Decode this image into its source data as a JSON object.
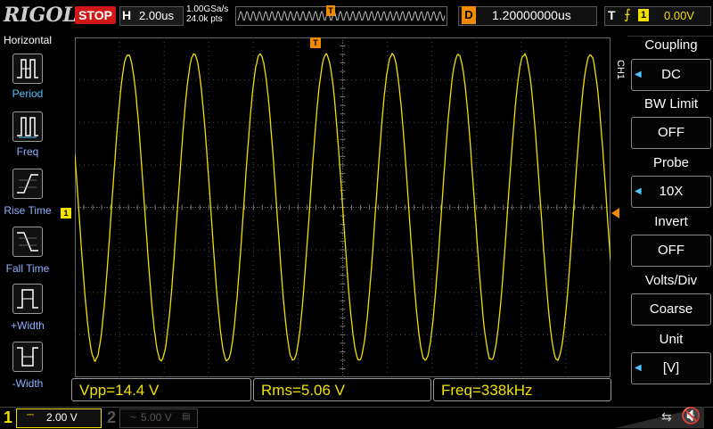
{
  "topbar": {
    "brand": "RIGOL",
    "run_status": "STOP",
    "horizontal_label": "H",
    "timebase": "2.00us",
    "sample_rate": "1.00GSa/s",
    "memory_depth": "24.0k pts",
    "trigger_marker": "T",
    "delay_label": "D",
    "delay_value": "1.20000000us",
    "trigger_label": "T",
    "trigger_source": "1",
    "trigger_level": "0.00V"
  },
  "left_menu": {
    "title": "Horizontal",
    "items": [
      {
        "label": "Period",
        "icon": "period-icon"
      },
      {
        "label": "Freq",
        "icon": "frequency-icon"
      },
      {
        "label": "Rise Time",
        "icon": "rise-time-icon"
      },
      {
        "label": "Fall Time",
        "icon": "fall-time-icon"
      },
      {
        "label": "+Width",
        "icon": "positive-width-icon"
      },
      {
        "label": "-Width",
        "icon": "negative-width-icon"
      }
    ]
  },
  "waveform": {
    "channel": "1",
    "color": "#f0e000",
    "vpp_volts": 14.4,
    "frequency_khz": 338,
    "timebase_us_per_div": 2.0,
    "volts_per_div": 2.0,
    "channel_marker": "1",
    "trigger_marker": "T"
  },
  "measurements": {
    "vpp": "Vpp=14.4 V",
    "rms": "Rms=5.06 V",
    "freq": "Freq=338kHz"
  },
  "right_menu": {
    "channel": "CH1",
    "items": [
      {
        "title": "Coupling",
        "value": "DC"
      },
      {
        "title": "BW Limit",
        "value": "OFF"
      },
      {
        "title": "Probe",
        "value": "10X"
      },
      {
        "title": "Invert",
        "value": "OFF"
      },
      {
        "title": "Volts/Div",
        "value": "Coarse"
      },
      {
        "title": "Unit",
        "value": "[V]"
      }
    ]
  },
  "bottombar": {
    "ch1_number": "1",
    "ch1_coupling": "⎓",
    "ch1_scale": "2.00 V",
    "ch2_number": "2",
    "ch2_coupling": "~",
    "ch2_scale": "5.00 V",
    "ch2_icon": "▤"
  },
  "colors": {
    "ch1": "#f0e000",
    "accent": "#f08a00",
    "stop": "#d01818",
    "menu_label": "#4fc3ff"
  }
}
